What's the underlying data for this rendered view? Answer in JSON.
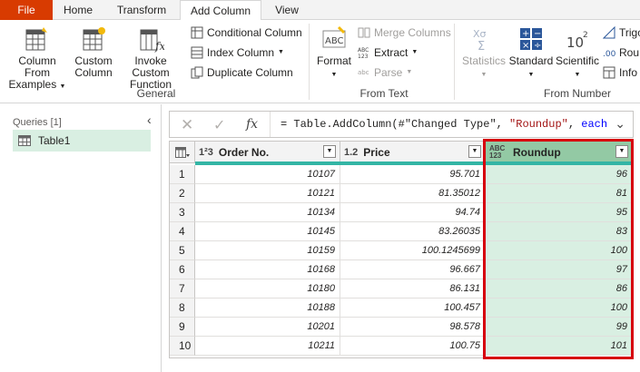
{
  "tabs": [
    "File",
    "Home",
    "Transform",
    "Add Column",
    "View"
  ],
  "ribbon": {
    "general": {
      "label": "General",
      "column_from_examples": [
        "Column From",
        "Examples"
      ],
      "custom_column": [
        "Custom",
        "Column"
      ],
      "invoke_custom_function": [
        "Invoke Custom",
        "Function"
      ],
      "conditional_column": "Conditional Column",
      "index_column": "Index Column",
      "duplicate_column": "Duplicate Column"
    },
    "from_text": {
      "label": "From Text",
      "format": "Format",
      "merge_columns": "Merge Columns",
      "extract": "Extract",
      "parse": "Parse"
    },
    "from_number": {
      "label": "From Number",
      "statistics": "Statistics",
      "standard": "Standard",
      "scientific": "Scientific",
      "trig": "Trigo",
      "rounding": "Rou",
      "info": "Info"
    }
  },
  "queries": {
    "title": "Queries [1]",
    "items": [
      "Table1"
    ]
  },
  "formula_bar": {
    "prefix": "= Table.AddColumn(#\"Changed Type\", ",
    "string": "\"Roundup\"",
    "sep": ", ",
    "keyword": "each"
  },
  "table": {
    "columns": [
      {
        "type": "1²3",
        "name": "Order No."
      },
      {
        "type": "1.2",
        "name": "Price"
      },
      {
        "type": "ABC 123",
        "name": "Roundup"
      }
    ],
    "rows": [
      {
        "n": "1",
        "order": "10107",
        "price": "95.701",
        "roundup": "96"
      },
      {
        "n": "2",
        "order": "10121",
        "price": "81.35012",
        "roundup": "81"
      },
      {
        "n": "3",
        "order": "10134",
        "price": "94.74",
        "roundup": "95"
      },
      {
        "n": "4",
        "order": "10145",
        "price": "83.26035",
        "roundup": "83"
      },
      {
        "n": "5",
        "order": "10159",
        "price": "100.1245699",
        "roundup": "100"
      },
      {
        "n": "6",
        "order": "10168",
        "price": "96.667",
        "roundup": "97"
      },
      {
        "n": "7",
        "order": "10180",
        "price": "86.131",
        "roundup": "86"
      },
      {
        "n": "8",
        "order": "10188",
        "price": "100.457",
        "roundup": "100"
      },
      {
        "n": "9",
        "order": "10201",
        "price": "98.578",
        "roundup": "99"
      },
      {
        "n": "10",
        "order": "10211",
        "price": "100.75",
        "roundup": "101"
      }
    ]
  }
}
